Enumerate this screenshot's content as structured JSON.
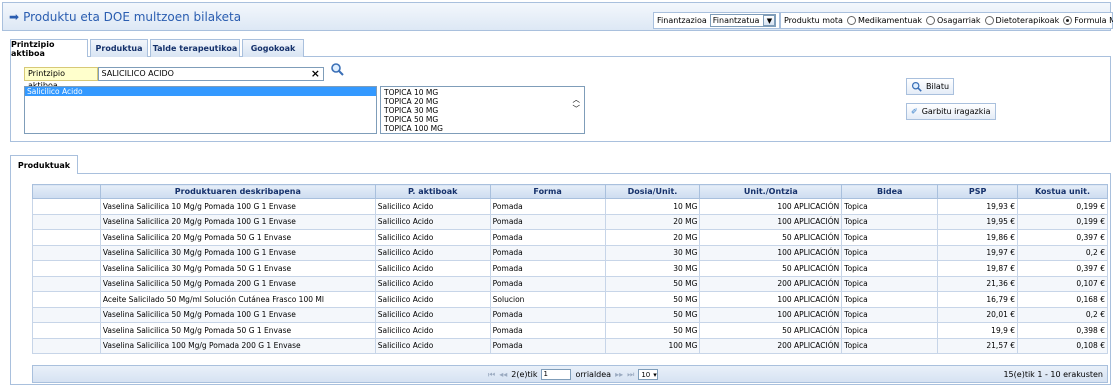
{
  "header": {
    "title": "Produktu eta DOE multzoen bilaketa",
    "finantzazioa_label": "Finantzazioa",
    "finantzazioa_value": "Finantzatua",
    "mota_label": "Produktu mota",
    "mota_options": [
      "Medikamentuak",
      "Osagarriak",
      "Dietoterapikoak",
      "Formula Magistralak"
    ],
    "mota_selected": "Formula Magistralak"
  },
  "tabs": [
    "Printzipio aktiboa",
    "Produktua",
    "Talde terapeutikoa",
    "Gogokoak"
  ],
  "search": {
    "label": "Printzipio aktiboa",
    "value": "SALICILICO ACIDO"
  },
  "left_list": [
    "Salicilico Acido"
  ],
  "right_list": [
    "TOPICA 10 MG",
    "TOPICA 20 MG",
    "TOPICA 30 MG",
    "TOPICA 50 MG",
    "TOPICA 100 MG"
  ],
  "buttons": {
    "search": "Bilatu",
    "clear": "Garbitu iragazkia"
  },
  "results_tab": "Produktuak",
  "table": {
    "headers": [
      "Produktuaren deskribapena",
      "P. aktiboak",
      "Forma",
      "Dosia/Unit.",
      "Unit./Ontzia",
      "Bidea",
      "PSP",
      "Kostua unit."
    ],
    "rows": [
      [
        "Vaselina Salicilica 10 Mg/g Pomada 100 G 1 Envase",
        "Salicilico Acido",
        "Pomada",
        "10 MG",
        "100 APLICACIÓN",
        "Topica",
        "19,93 €",
        "0,199 €"
      ],
      [
        "Vaselina Salicilica 20 Mg/g Pomada 100 G 1 Envase",
        "Salicilico Acido",
        "Pomada",
        "20 MG",
        "100 APLICACIÓN",
        "Topica",
        "19,95 €",
        "0,199 €"
      ],
      [
        "Vaselina Salicilica 20 Mg/g Pomada 50 G 1 Envase",
        "Salicilico Acido",
        "Pomada",
        "20 MG",
        "50 APLICACIÓN",
        "Topica",
        "19,86 €",
        "0,397 €"
      ],
      [
        "Vaselina Salicilica 30 Mg/g Pomada 100 G 1 Envase",
        "Salicilico Acido",
        "Pomada",
        "30 MG",
        "100 APLICACIÓN",
        "Topica",
        "19,97 €",
        "0,2 €"
      ],
      [
        "Vaselina Salicilica 30 Mg/g Pomada 50 G 1 Envase",
        "Salicilico Acido",
        "Pomada",
        "30 MG",
        "50 APLICACIÓN",
        "Topica",
        "19,87 €",
        "0,397 €"
      ],
      [
        "Vaselina Salicilica 50 Mg/g Pomada 200 G 1 Envase",
        "Salicilico Acido",
        "Pomada",
        "50 MG",
        "200 APLICACIÓN",
        "Topica",
        "21,36 €",
        "0,107 €"
      ],
      [
        "Aceite Salicilado 50 Mg/ml Solución Cutánea Frasco 100 Ml",
        "Salicilico Acido",
        "Solucion",
        "50 MG",
        "100 APLICACIÓN",
        "Topica",
        "16,79 €",
        "0,168 €"
      ],
      [
        "Vaselina Salicilica 50 Mg/g Pomada 100 G 1 Envase",
        "Salicilico Acido",
        "Pomada",
        "50 MG",
        "100 APLICACIÓN",
        "Topica",
        "20,01 €",
        "0,2 €"
      ],
      [
        "Vaselina Salicilica 50 Mg/g Pomada 50 G 1 Envase",
        "Salicilico Acido",
        "Pomada",
        "50 MG",
        "50 APLICACIÓN",
        "Topica",
        "19,9 €",
        "0,398 €"
      ],
      [
        "Vaselina Salicilica 100 Mg/g Pomada 200 G 1 Envase",
        "Salicilico Acido",
        "Pomada",
        "100 MG",
        "200 APLICACIÓN",
        "Topica",
        "21,57 €",
        "0,108 €"
      ]
    ]
  },
  "pager": {
    "of_pages": "2(e)tik",
    "page": "1",
    "page_label": "orrialdea",
    "per_page": "10",
    "summary": "15(e)tik 1 - 10 erakusten"
  },
  "colors": {
    "accent": "#2a5db0",
    "border": "#a9c0dd",
    "selection": "#3399ff"
  }
}
